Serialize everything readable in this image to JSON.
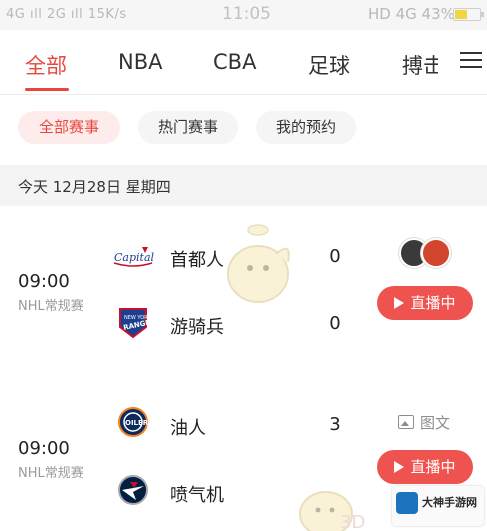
{
  "status_bar": {
    "left": "4G ıll  2G ıll  15K/s",
    "time": "11:05",
    "right": "HD 4G 43%"
  },
  "tabs": [
    {
      "label": "全部",
      "active": true
    },
    {
      "label": "NBA",
      "active": false
    },
    {
      "label": "CBA",
      "active": false
    },
    {
      "label": "足球",
      "active": false
    },
    {
      "label": "搏击",
      "active": false
    }
  ],
  "filters": [
    {
      "label": "全部赛事",
      "active": true
    },
    {
      "label": "热门赛事",
      "active": false
    },
    {
      "label": "我的预约",
      "active": false
    }
  ],
  "date_header": "今天 12月28日 星期四",
  "matches": [
    {
      "time": "09:00",
      "league": "NHL常规赛",
      "home": {
        "name": "首都人",
        "score": "0",
        "logo": "capitals-logo"
      },
      "away": {
        "name": "游骑兵",
        "score": "0",
        "logo": "rangers-logo"
      },
      "action": "直播中"
    },
    {
      "time": "09:00",
      "league": "NHL常规赛",
      "home": {
        "name": "油人",
        "score": "3",
        "logo": "oilers-logo"
      },
      "away": {
        "name": "喷气机",
        "score": "",
        "logo": "jets-logo"
      },
      "graphic_label": "图文",
      "action": "直播中"
    }
  ],
  "watermark": "大神手游网",
  "watermark_small": "3D",
  "colors": {
    "accent": "#e8473e",
    "live_button": "#ef5350"
  }
}
